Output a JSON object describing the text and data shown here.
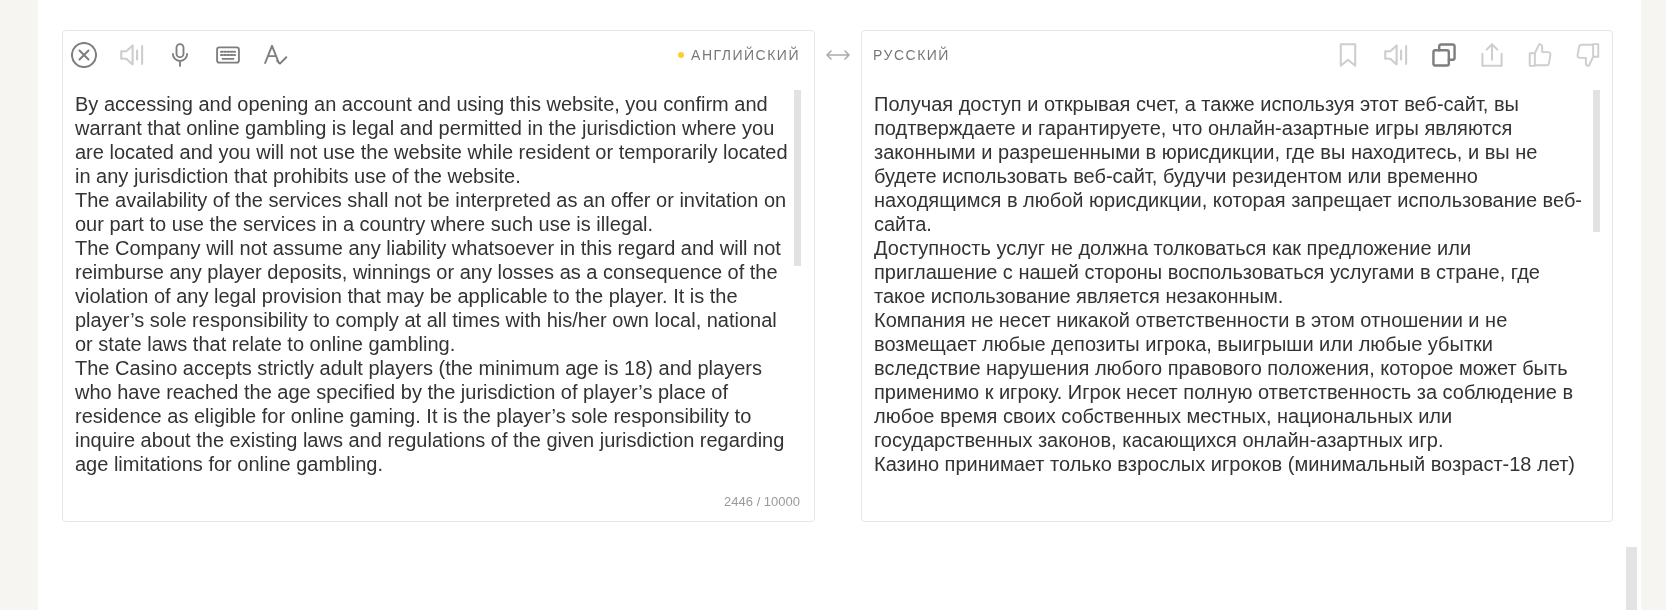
{
  "source": {
    "toolbar": [
      {
        "kind": "clear",
        "disabled": false
      },
      {
        "kind": "speaker",
        "disabled": true
      },
      {
        "kind": "microphone",
        "disabled": false
      },
      {
        "kind": "keyboard",
        "disabled": false
      },
      {
        "kind": "spellcheck",
        "disabled": false
      }
    ],
    "language": {
      "label": "АНГЛИЙСКИЙ",
      "dot": true
    },
    "paragraphs": [
      "By accessing and opening an account and using this website, you confirm and warrant that online gambling is legal and permitted in the jurisdiction where you are located and you will not use the website while resident or temporarily located in any jurisdiction that prohibits use of the website.",
      "The availability of the services shall not be interpreted as an offer or invitation on our part to use the services in a country where such use is illegal.",
      "The Company will not assume any liability whatsoever in this regard and will not reimburse any player deposits, winnings or any losses as a consequence of the violation of any legal provision that may be applicable to the player. It is the player’s sole responsibility to comply at all times with his/her own local, national or state laws that relate to online gambling.",
      "The Casino accepts strictly adult players (the minimum age is 18) and players who have reached the age specified by the jurisdiction of player’s place of residence as eligible for online gaming. It is the player’s sole responsibility to inquire about the existing laws and regulations of the given jurisdiction regarding age limitations for online gambling."
    ],
    "counter": "2446 / 10000"
  },
  "target": {
    "language": {
      "label": "РУССКИЙ"
    },
    "toolbar": [
      {
        "kind": "bookmark",
        "disabled": true
      },
      {
        "kind": "speaker",
        "disabled": true
      },
      {
        "kind": "copy",
        "disabled": false
      },
      {
        "kind": "share",
        "disabled": true
      },
      {
        "kind": "like",
        "disabled": true
      },
      {
        "kind": "dislike",
        "disabled": true
      }
    ],
    "paragraphs": [
      "Получая доступ и открывая счет, а также используя этот веб-сайт, вы подтверждаете и гарантируете, что онлайн-азартные игры являются законными и разрешенными в юрисдикции, где вы находитесь, и вы не будете использовать веб-сайт, будучи резидентом или временно находящимся в любой юрисдикции, которая запрещает использование веб-сайта.",
      "Доступность услуг не должна толковаться как предложение или приглашение с нашей стороны воспользоваться услугами в стране, где такое использование является незаконным.",
      "Компания не несет никакой ответственности в этом отношении и не возмещает любые депозиты игрока, выигрыши или любые убытки вследствие нарушения любого правового положения, которое может быть применимо к игроку. Игрок несет полную ответственность за соблюдение в любое время своих собственных местных, национальных или государственных законов, касающихся онлайн-азартных игр.",
      "Казино принимает только взрослых игроков (минимальный возраст-18 лет)"
    ]
  }
}
